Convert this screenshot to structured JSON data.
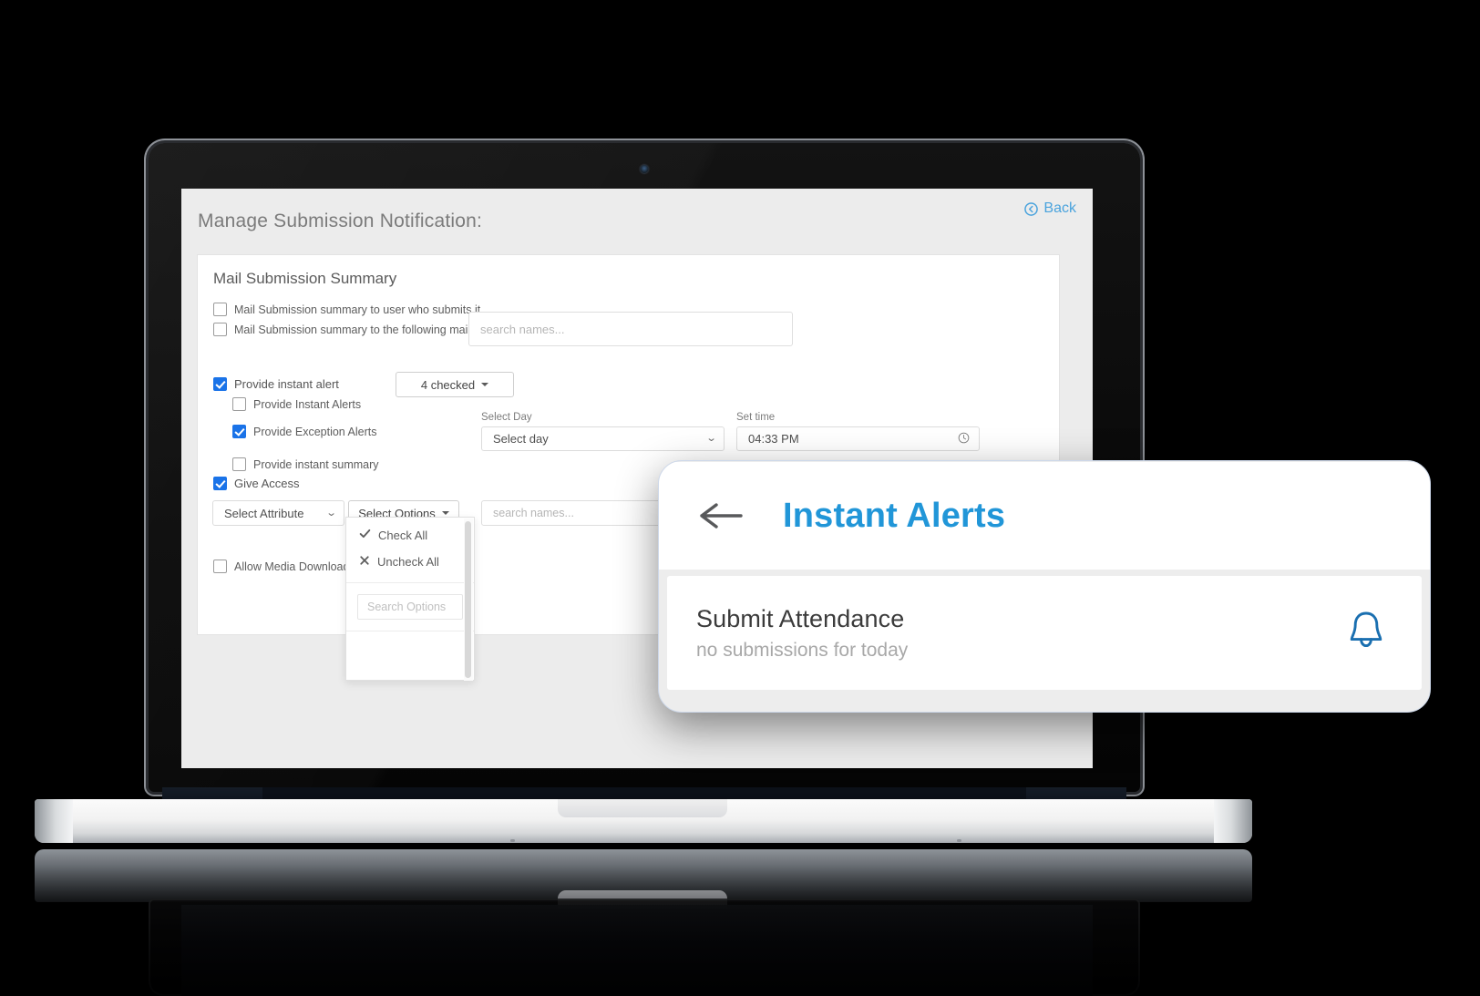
{
  "app": {
    "page_title": "Manage Submission Notification:",
    "back_label": "Back",
    "back_icon": "circle-left-arrow-icon",
    "panel_title": "Mail Submission Summary",
    "checkboxes": {
      "mail_to_submitter": {
        "label": "Mail Submission summary to user who submits it.",
        "checked": false
      },
      "mail_to_mail_id": {
        "label": "Mail Submission summary to the following mail id",
        "checked": false
      },
      "provide_instant_alert": {
        "label": "Provide instant alert",
        "checked": true
      },
      "provide_instant_alerts": {
        "label": "Provide Instant Alerts",
        "checked": false
      },
      "provide_exception_alerts": {
        "label": "Provide Exception Alerts",
        "checked": true
      },
      "provide_instant_summary": {
        "label": "Provide instant summary",
        "checked": false
      },
      "give_access": {
        "label": "Give Access",
        "checked": true
      },
      "allow_media_download": {
        "label": "Allow Media Download",
        "checked": false
      }
    },
    "inputs": {
      "mail_id_search_placeholder": "search names...",
      "access_search_placeholder": "search names..."
    },
    "checked_button_label": "4 checked",
    "select_day": {
      "label": "Select Day",
      "value": "Select day"
    },
    "set_time": {
      "label": "Set time",
      "value": "04:33 PM",
      "icon": "clock-icon"
    },
    "select_attribute": {
      "value": "Select Attribute"
    },
    "select_options_button": {
      "label": "Select Options"
    },
    "dropdown": {
      "check_all": {
        "label": "Check All",
        "icon": "check-icon"
      },
      "uncheck_all": {
        "label": "Uncheck All",
        "icon": "cross-icon"
      },
      "search_placeholder": "Search Options"
    }
  },
  "mobile": {
    "back_icon": "arrow-left-icon",
    "title": "Instant Alerts",
    "alert": {
      "title": "Submit Attendance",
      "subtitle": "no submissions for today",
      "icon": "bell-icon"
    }
  },
  "colors": {
    "accent_blue": "#2196d8",
    "checkbox_blue": "#1a73e8",
    "back_link_blue": "#4aa3dd",
    "bell_blue": "#1a6fb0"
  }
}
